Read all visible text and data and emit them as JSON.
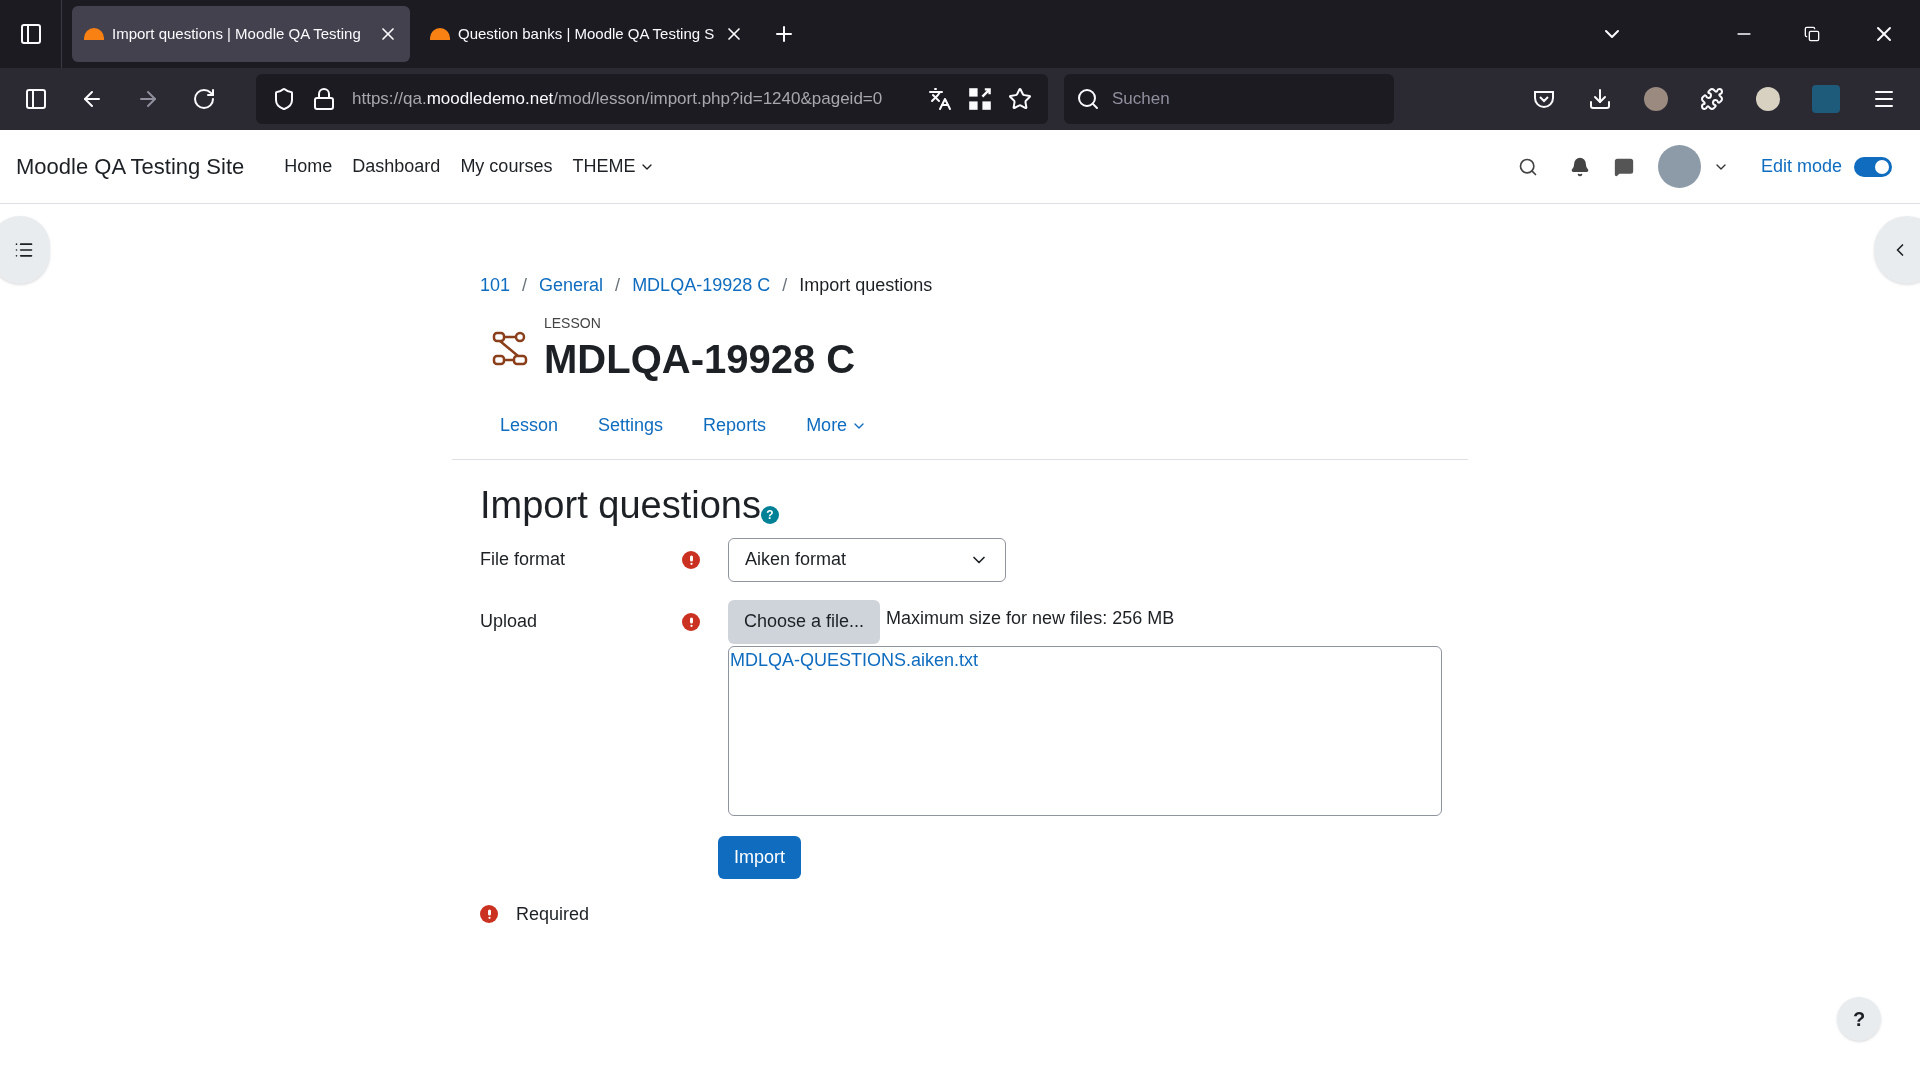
{
  "browser": {
    "tabs": [
      {
        "title": "Import questions | Moodle QA Testing",
        "selected": true
      },
      {
        "title": "Question banks | Moodle QA Testing S",
        "selected": false
      }
    ],
    "url": {
      "scheme": "https://qa.",
      "host": "moodledemo.net",
      "path": "/mod/lesson/import.php?id=1240&pageid=0"
    },
    "search": {
      "placeholder": "Suchen"
    }
  },
  "site": {
    "name": "Moodle QA Testing Site",
    "nav": [
      {
        "label": "Home",
        "dropdown": false
      },
      {
        "label": "Dashboard",
        "dropdown": false
      },
      {
        "label": "My courses",
        "dropdown": false
      },
      {
        "label": "THEME",
        "dropdown": true
      }
    ],
    "edit_mode": {
      "label": "Edit mode",
      "on": true
    }
  },
  "breadcrumb_separator": "/",
  "breadcrumb": [
    {
      "label": "101",
      "link": true
    },
    {
      "label": "General",
      "link": true
    },
    {
      "label": "MDLQA-19928 C",
      "link": true
    },
    {
      "label": "Import questions",
      "link": false
    }
  ],
  "activity": {
    "type": "LESSON",
    "title": "MDLQA-19928 C"
  },
  "tabs": [
    {
      "label": "Lesson",
      "dropdown": false
    },
    {
      "label": "Settings",
      "dropdown": false
    },
    {
      "label": "Reports",
      "dropdown": false
    },
    {
      "label": "More",
      "dropdown": true
    }
  ],
  "form": {
    "heading": "Import questions",
    "file_format": {
      "label": "File format",
      "value": "Aiken format"
    },
    "upload": {
      "label": "Upload",
      "button": "Choose a file...",
      "max_size": "Maximum size for new files: 256 MB",
      "files": [
        "MDLQA-QUESTIONS.aiken.txt"
      ]
    },
    "submit": "Import",
    "required_note": "Required"
  },
  "help": "?"
}
